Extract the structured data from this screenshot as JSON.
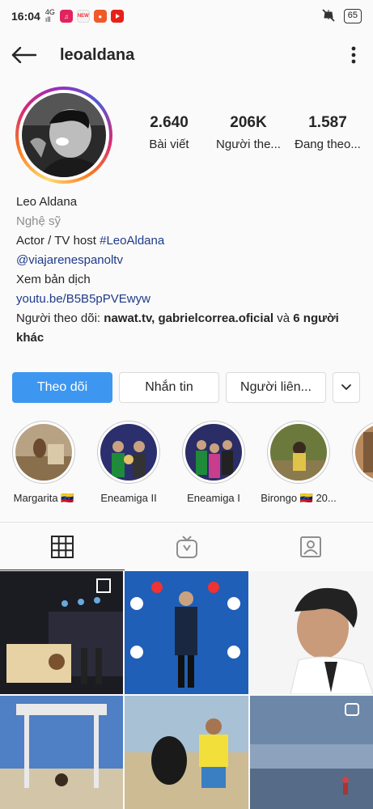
{
  "status_bar": {
    "time": "16:04",
    "network_top": "4G",
    "network_bottom": "ıll",
    "app1_label": "♫",
    "app2_label": "NEW",
    "app3_label": "●",
    "battery": "65"
  },
  "header": {
    "username": "leoaldana"
  },
  "stats": [
    {
      "num": "2.640",
      "label": "Bài viết"
    },
    {
      "num": "206K",
      "label": "Người the..."
    },
    {
      "num": "1.587",
      "label": "Đang theo..."
    }
  ],
  "bio": {
    "name": "Leo Aldana",
    "category": "Nghệ sỹ",
    "description_text": "Actor / TV host ",
    "description_hashtag": "#LeoAldana",
    "mention": "@viajarenespanoltv",
    "translate": "Xem bản dịch",
    "website": "youtu.be/B5B5pPVEwyw",
    "followed_by_prefix": "Người theo dõi: ",
    "followed_by_names": "nawat.tv, gabrielcorrea.oficial",
    "followed_by_and": " và ",
    "followed_by_others_line1": "6 người",
    "followed_by_others_line2": "khác"
  },
  "actions": {
    "follow": "Theo dõi",
    "message": "Nhắn tin",
    "contact": "Người liên...",
    "chevron": "⌄"
  },
  "highlights": [
    {
      "label": "Margarita 🇻🇪"
    },
    {
      "label": "Eneamiga II"
    },
    {
      "label": "Eneamiga I"
    },
    {
      "label": "Birongo 🇻🇪 20..."
    },
    {
      "label": "🥇"
    }
  ],
  "tabs": [
    {
      "icon": "grid-icon"
    },
    {
      "icon": "igtv-icon"
    },
    {
      "icon": "tagged-icon"
    }
  ],
  "colors": {
    "follow_button": "#3d97f0",
    "link": "#1e3a8a",
    "muted": "#8e8e8e"
  }
}
